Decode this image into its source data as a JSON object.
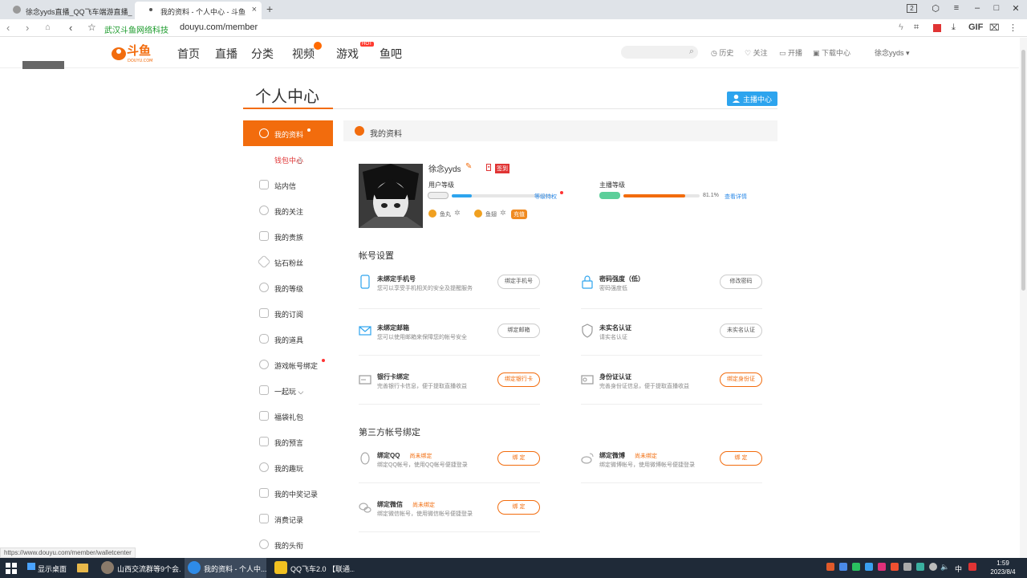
{
  "browser": {
    "tabs": [
      {
        "title": "徐念yyds直播_QQ飞车端游直播_斗"
      },
      {
        "title": "我的资料 - 个人中心 - 斗鱼"
      }
    ],
    "site_tag": "武汉斗鱼网络科技",
    "url": "douyu.com/member",
    "toolbar_gif": "GIF",
    "status_url": "https://www.douyu.com/member/walletcenter"
  },
  "header": {
    "logo_text": "斗鱼",
    "logo_sub": "DOUYU.COM",
    "nav": [
      "首页",
      "直播",
      "分类",
      "视频",
      "游戏",
      "鱼吧"
    ],
    "hot_label": "HOT",
    "links": [
      "历史",
      "关注",
      "开播",
      "下载中心"
    ],
    "username": "徐念yyds ▾"
  },
  "page": {
    "title": "个人中心",
    "anchor_center": "主播中心"
  },
  "sidebar": {
    "items": [
      {
        "label": "我的资料",
        "active": true,
        "dot": true
      },
      {
        "label": "钱包中心",
        "sub": true
      },
      {
        "label": "站内信"
      },
      {
        "label": "我的关注"
      },
      {
        "label": "我的贵族"
      },
      {
        "label": "钻石粉丝"
      },
      {
        "label": "我的等级"
      },
      {
        "label": "我的订阅"
      },
      {
        "label": "我的道具"
      },
      {
        "label": "游戏帐号绑定",
        "dot": true
      },
      {
        "label": "一起玩 ⌵"
      },
      {
        "label": "福袋礼包"
      },
      {
        "label": "我的预言"
      },
      {
        "label": "我的趣玩"
      },
      {
        "label": "我的中奖记录"
      },
      {
        "label": "消费记录"
      },
      {
        "label": "我的头衔"
      }
    ]
  },
  "profile": {
    "section_title": "我的资料",
    "nickname": "徐念yyds",
    "sign_tag": "签到",
    "user_level_label": "用户等级",
    "user_level_progress": 0.2,
    "level_privilege": "等级特权",
    "fish_balls": "鱼丸",
    "fish_wings": "鱼翅",
    "recharge": "充值",
    "anchor_level_label": "主播等级",
    "anchor_level_pct": "81.1%",
    "anchor_level_progress": 0.811,
    "view_details": "查看详情"
  },
  "account_settings": {
    "title": "帐号设置",
    "rows": [
      {
        "title": "未绑定手机号",
        "desc": "您可以享受手机相关的安全及提醒服务",
        "button": "绑定手机号",
        "highlight": false
      },
      {
        "title": "密码强度（低）",
        "desc": "密码强度低",
        "button": "修改密码",
        "highlight": false
      },
      {
        "title": "未绑定邮箱",
        "desc": "您可以使用邮箱来保障您的帐号安全",
        "button": "绑定邮箱",
        "highlight": false
      },
      {
        "title": "未实名认证",
        "desc": "请实名认证",
        "button": "未实名认证",
        "highlight": false
      },
      {
        "title": "银行卡绑定",
        "desc": "完善银行卡信息，便于提取直播收益",
        "button": "绑定银行卡",
        "highlight": true
      },
      {
        "title": "身份证认证",
        "desc": "完善身份证信息，便于提取直播收益",
        "button": "绑定身份证",
        "highlight": true
      }
    ]
  },
  "third_party": {
    "title": "第三方帐号绑定",
    "rows": [
      {
        "title": "绑定QQ",
        "status": "尚未绑定",
        "desc": "绑定QQ帐号，使用QQ帐号便捷登录",
        "button": "绑 定"
      },
      {
        "title": "绑定微博",
        "status": "尚未绑定",
        "desc": "绑定微博帐号，使用微博帐号便捷登录",
        "button": "绑 定"
      },
      {
        "title": "绑定微信",
        "status": "尚未绑定",
        "desc": "绑定微信帐号，使用微信帐号便捷登录",
        "button": "绑 定"
      }
    ]
  },
  "taskbar": {
    "desktop": "显示桌面",
    "apps": [
      "山西交流群等9个会...",
      "我的资料 - 个人中...",
      "QQ飞车2.0 【联通..."
    ],
    "ime": "中",
    "time": "1:59",
    "date": "2023/8/4"
  },
  "colors": {
    "accent": "#f26c0d",
    "link": "#2e8be8",
    "anchor_button": "#2da4ee",
    "red_dot": "#ff3333"
  }
}
